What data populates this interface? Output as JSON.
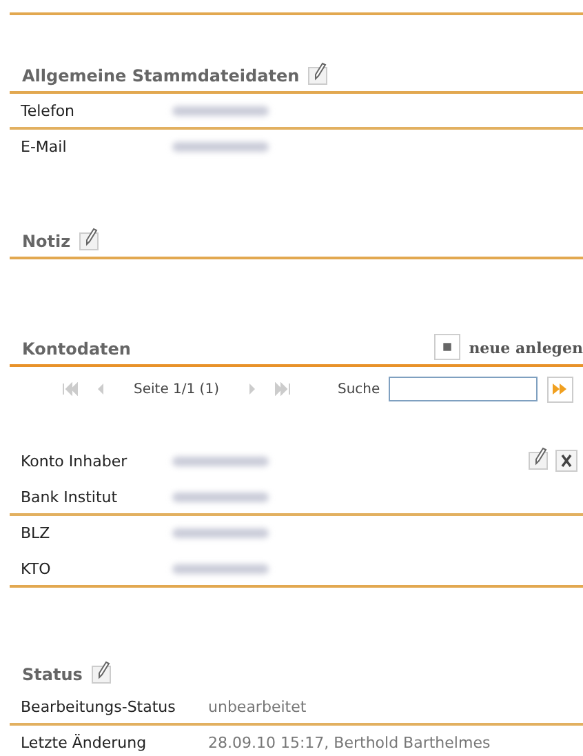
{
  "general": {
    "title": "Allgemeine Stammdateidaten",
    "editable": true,
    "rows": [
      {
        "label": "Telefon",
        "blurred": true
      },
      {
        "label": "E-Mail",
        "blurred": true
      }
    ]
  },
  "note": {
    "title": "Notiz",
    "editable": true
  },
  "accounts": {
    "title": "Kontodaten",
    "new_button": "neue anlegen",
    "pager": {
      "page": "Seite 1/1 (1)",
      "search_label": "Suche"
    },
    "rows": [
      {
        "label": "Konto Inhaber",
        "blurred": true
      },
      {
        "label": "Bank Institut",
        "blurred": true
      },
      {
        "label": "BLZ",
        "blurred": true
      },
      {
        "label": "KTO",
        "blurred": true
      }
    ]
  },
  "status": {
    "title": "Status",
    "editable": true,
    "rows": [
      {
        "label": "Bearbeitungs-Status",
        "value": "unbearbeitet"
      },
      {
        "label": "Letzte Änderung",
        "value": "28.09.10 15:17, Berthold Barthelmes"
      }
    ]
  }
}
